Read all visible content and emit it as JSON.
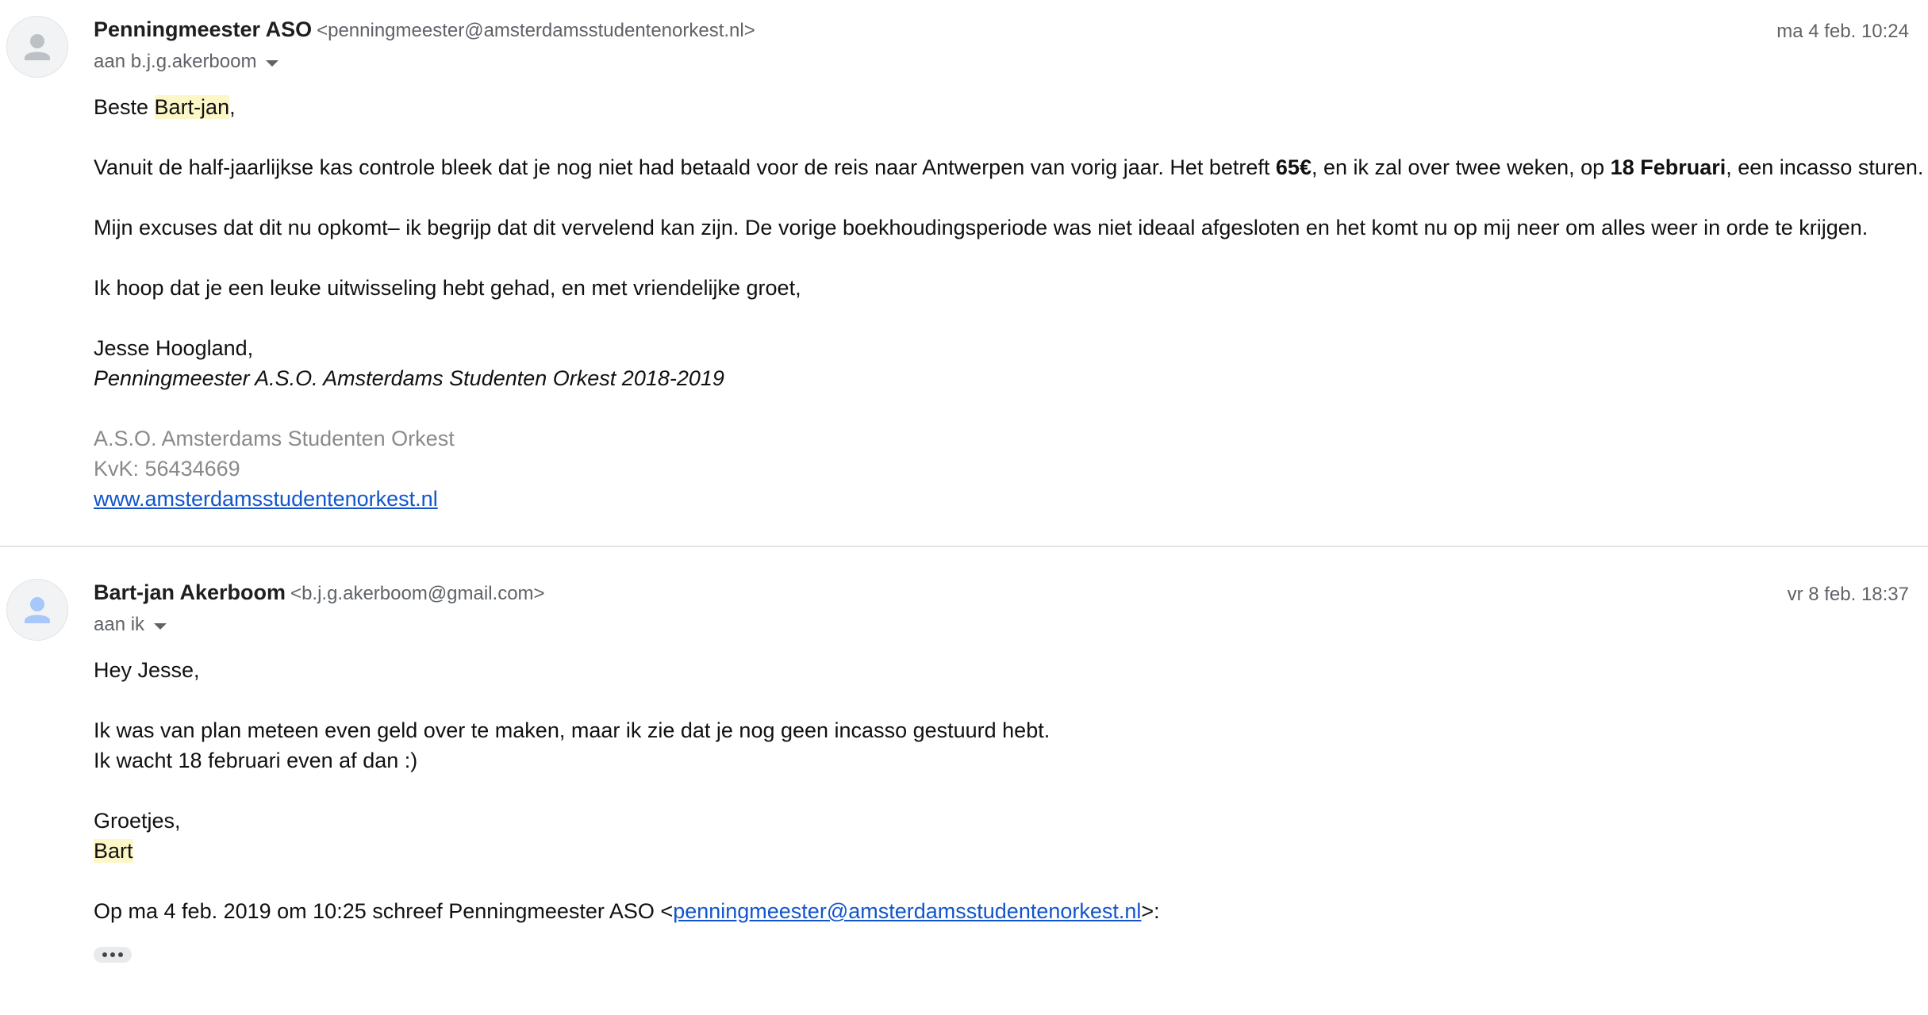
{
  "messages": [
    {
      "sender_name": "Penningmeester ASO",
      "sender_email": "<penningmeester@amsterdamsstudentenorkest.nl>",
      "date": "ma 4 feb. 10:24",
      "recipient": "aan b.j.g.akerboom",
      "greeting_prefix": "Beste ",
      "greeting_name": "Bart-jan",
      "greeting_suffix": ",",
      "para1_a": "Vanuit de half-jaarlijkse kas controle bleek dat je nog niet had betaald voor de reis naar Antwerpen van vorig jaar. Het betreft ",
      "para1_amount": "65€",
      "para1_b": ", en ik zal over twee weken, op ",
      "para1_date": "18 Februari",
      "para1_c": ", een incasso sturen.",
      "para2": "Mijn excuses dat dit nu opkomt– ik begrijp dat dit vervelend kan zijn. De vorige boekhoudingsperiode was niet ideaal afgesloten en het komt nu op mij neer om alles weer in orde te krijgen.",
      "para3": "Ik hoop dat je een leuke uitwisseling hebt gehad, en met vriendelijke groet,",
      "signature_name": "Jesse Hoogland,",
      "signature_title": "Penningmeester A.S.O. Amsterdams Studenten Orkest 2018-2019",
      "org_name": "A.S.O. Amsterdams Studenten Orkest",
      "org_kvk": "KvK: 56434669",
      "org_website": "www.amsterdamsstudentenorkest.nl"
    },
    {
      "sender_name": "Bart-jan Akerboom",
      "sender_email": "<b.j.g.akerboom@gmail.com>",
      "date": "vr 8 feb. 18:37",
      "recipient": "aan ik",
      "greeting": "Hey Jesse,",
      "line1": "Ik was van plan meteen even geld over te maken, maar ik zie dat je nog geen incasso gestuurd hebt.",
      "line2": "Ik wacht 18 februari even af dan :)",
      "closing": "Groetjes,",
      "sign_name": "Bart",
      "quote_prefix": "Op ma 4 feb. 2019 om 10:25 schreef Penningmeester ASO <",
      "quote_email": "penningmeester@amsterdamsstudentenorkest.nl",
      "quote_suffix": ">:"
    }
  ],
  "colors": {
    "highlight": "#fdf7c8",
    "link": "#1155cc",
    "muted": "#5f6368",
    "signature_grey": "#8a8a8a"
  },
  "icons": {
    "avatar": "default-person-avatar-icon",
    "dropdown": "caret-down-icon",
    "trimmed_content": "ellipsis-icon"
  }
}
